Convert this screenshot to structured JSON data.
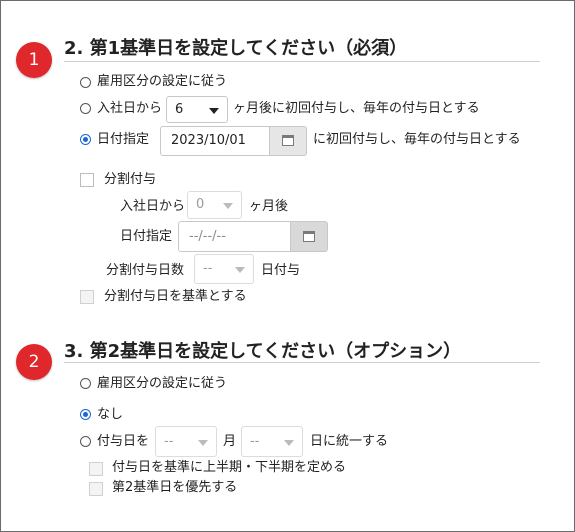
{
  "section1": {
    "badge": "1",
    "title": "2. 第1基準日を設定してください（必須）",
    "opt_follow": "雇用区分の設定に従う",
    "opt_hire_prefix": "入社日から",
    "opt_hire_months": "6",
    "opt_hire_suffix": "ヶ月後に初回付与し、毎年の付与日とする",
    "opt_date_label": "日付指定",
    "opt_date_value": "2023/10/01",
    "opt_date_suffix": "に初回付与し、毎年の付与日とする",
    "split_label": "分割付与",
    "split_hire_prefix": "入社日から",
    "split_hire_value": "0",
    "split_hire_suffix": "ヶ月後",
    "split_date_label": "日付指定",
    "split_date_placeholder": "--/--/--",
    "split_days_label": "分割付与日数",
    "split_days_value": "--",
    "split_days_suffix": "日付与",
    "split_base_label": "分割付与日を基準とする"
  },
  "section2": {
    "badge": "2",
    "title": "3. 第2基準日を設定してください（オプション）",
    "opt_follow": "雇用区分の設定に従う",
    "opt_none": "なし",
    "opt_grant_prefix": "付与日を",
    "grant_month_value": "--",
    "grant_month_unit": "月",
    "grant_day_value": "--",
    "grant_day_suffix": "日に統一する",
    "half_label": "付与日を基準に上半期・下半期を定める",
    "priority_label": "第2基準日を優先する"
  },
  "colors": {
    "accent": "#1a66d6",
    "badge": "#e0272b"
  }
}
